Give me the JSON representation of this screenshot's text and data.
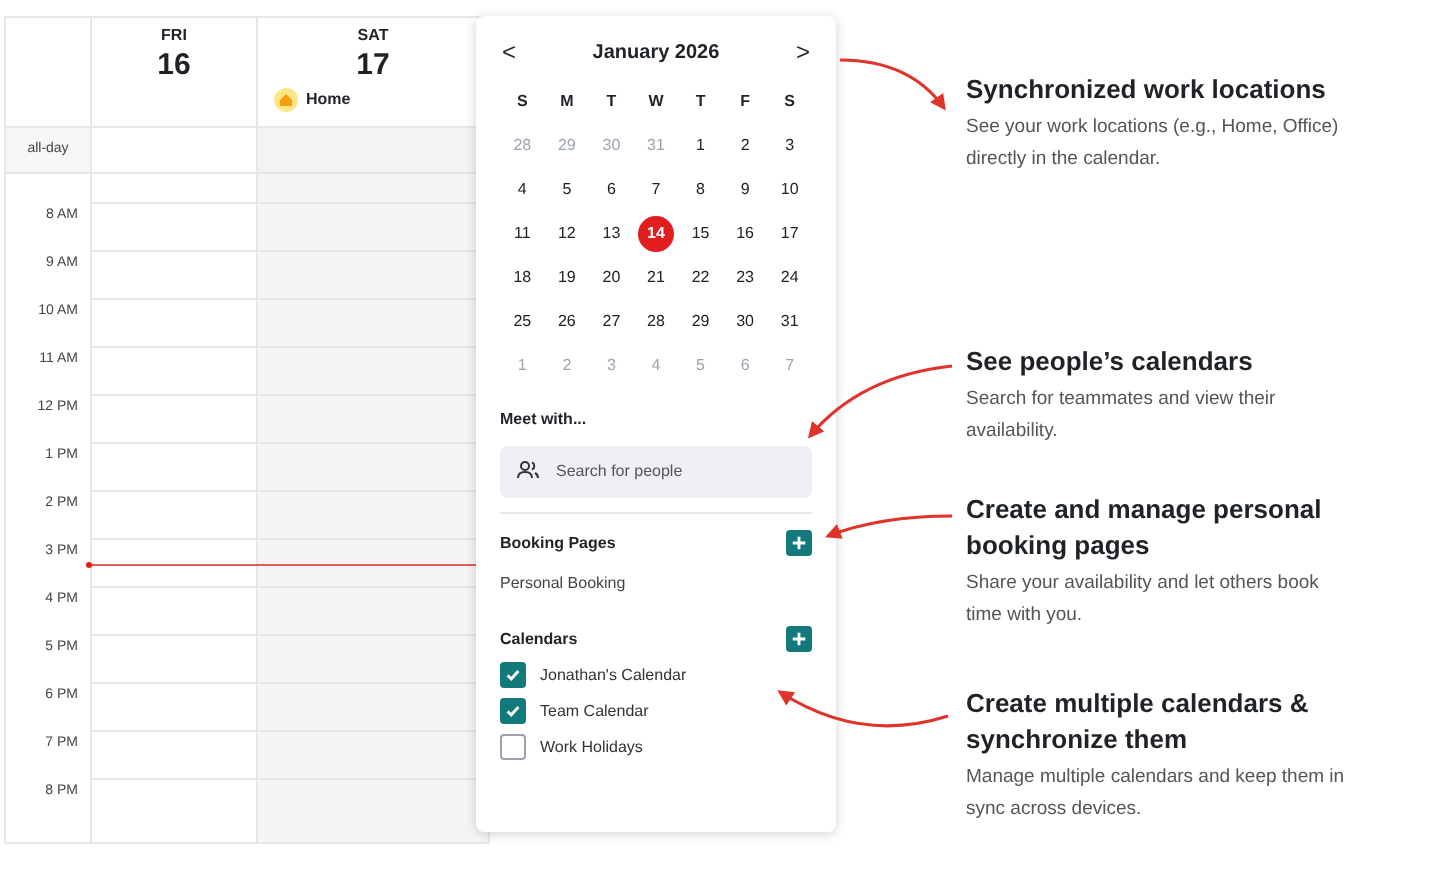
{
  "week_view": {
    "days": [
      {
        "weekday": "FRI",
        "date": "16",
        "weekend": false
      },
      {
        "weekday": "SAT",
        "date": "17",
        "weekend": true,
        "location": "Home"
      }
    ],
    "all_day_label": "all-day",
    "hours": [
      "8 AM",
      "9 AM",
      "10 AM",
      "11 AM",
      "12 PM",
      "1 PM",
      "2 PM",
      "3 PM",
      "4 PM",
      "5 PM",
      "6 PM",
      "7 PM",
      "8 PM"
    ]
  },
  "popup": {
    "month_title": "January 2026",
    "prev": "<",
    "next": ">",
    "weekdays": [
      "S",
      "M",
      "T",
      "W",
      "T",
      "F",
      "S"
    ],
    "weeks": [
      [
        {
          "label": "28",
          "outside": true,
          "selected": false
        },
        {
          "label": "29",
          "outside": true,
          "selected": false
        },
        {
          "label": "30",
          "outside": true,
          "selected": false
        },
        {
          "label": "31",
          "outside": true,
          "selected": false
        },
        {
          "label": "1",
          "outside": false,
          "selected": false
        },
        {
          "label": "2",
          "outside": false,
          "selected": false
        },
        {
          "label": "3",
          "outside": false,
          "selected": false
        }
      ],
      [
        {
          "label": "4",
          "outside": false,
          "selected": false
        },
        {
          "label": "5",
          "outside": false,
          "selected": false
        },
        {
          "label": "6",
          "outside": false,
          "selected": false
        },
        {
          "label": "7",
          "outside": false,
          "selected": false
        },
        {
          "label": "8",
          "outside": false,
          "selected": false
        },
        {
          "label": "9",
          "outside": false,
          "selected": false
        },
        {
          "label": "10",
          "outside": false,
          "selected": false
        }
      ],
      [
        {
          "label": "11",
          "outside": false,
          "selected": false
        },
        {
          "label": "12",
          "outside": false,
          "selected": false
        },
        {
          "label": "13",
          "outside": false,
          "selected": false
        },
        {
          "label": "14",
          "outside": false,
          "selected": true
        },
        {
          "label": "15",
          "outside": false,
          "selected": false
        },
        {
          "label": "16",
          "outside": false,
          "selected": false
        },
        {
          "label": "17",
          "outside": false,
          "selected": false
        }
      ],
      [
        {
          "label": "18",
          "outside": false,
          "selected": false
        },
        {
          "label": "19",
          "outside": false,
          "selected": false
        },
        {
          "label": "20",
          "outside": false,
          "selected": false
        },
        {
          "label": "21",
          "outside": false,
          "selected": false
        },
        {
          "label": "22",
          "outside": false,
          "selected": false
        },
        {
          "label": "23",
          "outside": false,
          "selected": false
        },
        {
          "label": "24",
          "outside": false,
          "selected": false
        }
      ],
      [
        {
          "label": "25",
          "outside": false,
          "selected": false
        },
        {
          "label": "26",
          "outside": false,
          "selected": false
        },
        {
          "label": "27",
          "outside": false,
          "selected": false
        },
        {
          "label": "28",
          "outside": false,
          "selected": false
        },
        {
          "label": "29",
          "outside": false,
          "selected": false
        },
        {
          "label": "30",
          "outside": false,
          "selected": false
        },
        {
          "label": "31",
          "outside": false,
          "selected": false
        }
      ],
      [
        {
          "label": "1",
          "outside": true,
          "selected": false
        },
        {
          "label": "2",
          "outside": true,
          "selected": false
        },
        {
          "label": "3",
          "outside": true,
          "selected": false
        },
        {
          "label": "4",
          "outside": true,
          "selected": false
        },
        {
          "label": "5",
          "outside": true,
          "selected": false
        },
        {
          "label": "6",
          "outside": true,
          "selected": false
        },
        {
          "label": "7",
          "outside": true,
          "selected": false
        }
      ]
    ],
    "meet_with": {
      "title": "Meet with...",
      "placeholder": "Search for people"
    },
    "booking_pages": {
      "title": "Booking Pages",
      "items": [
        "Personal Booking"
      ]
    },
    "calendars": {
      "title": "Calendars",
      "items": [
        {
          "name": "Jonathan's Calendar",
          "checked": true
        },
        {
          "name": "Team Calendar",
          "checked": true
        },
        {
          "name": "Work Holidays",
          "checked": false
        }
      ]
    }
  },
  "callouts": [
    {
      "title": "Synchronized work locations",
      "body": "See your work locations (e.g., Home, Office) directly in the calendar."
    },
    {
      "title": "See people’s calendars",
      "body": "Search for teammates and view their availability."
    },
    {
      "title": "Create and manage personal booking pages",
      "body": "Share your availability and let others book time with you."
    },
    {
      "title": "Create multiple calendars & synchronize them",
      "body": "Manage multiple calendars and keep them in sync across devices."
    }
  ]
}
